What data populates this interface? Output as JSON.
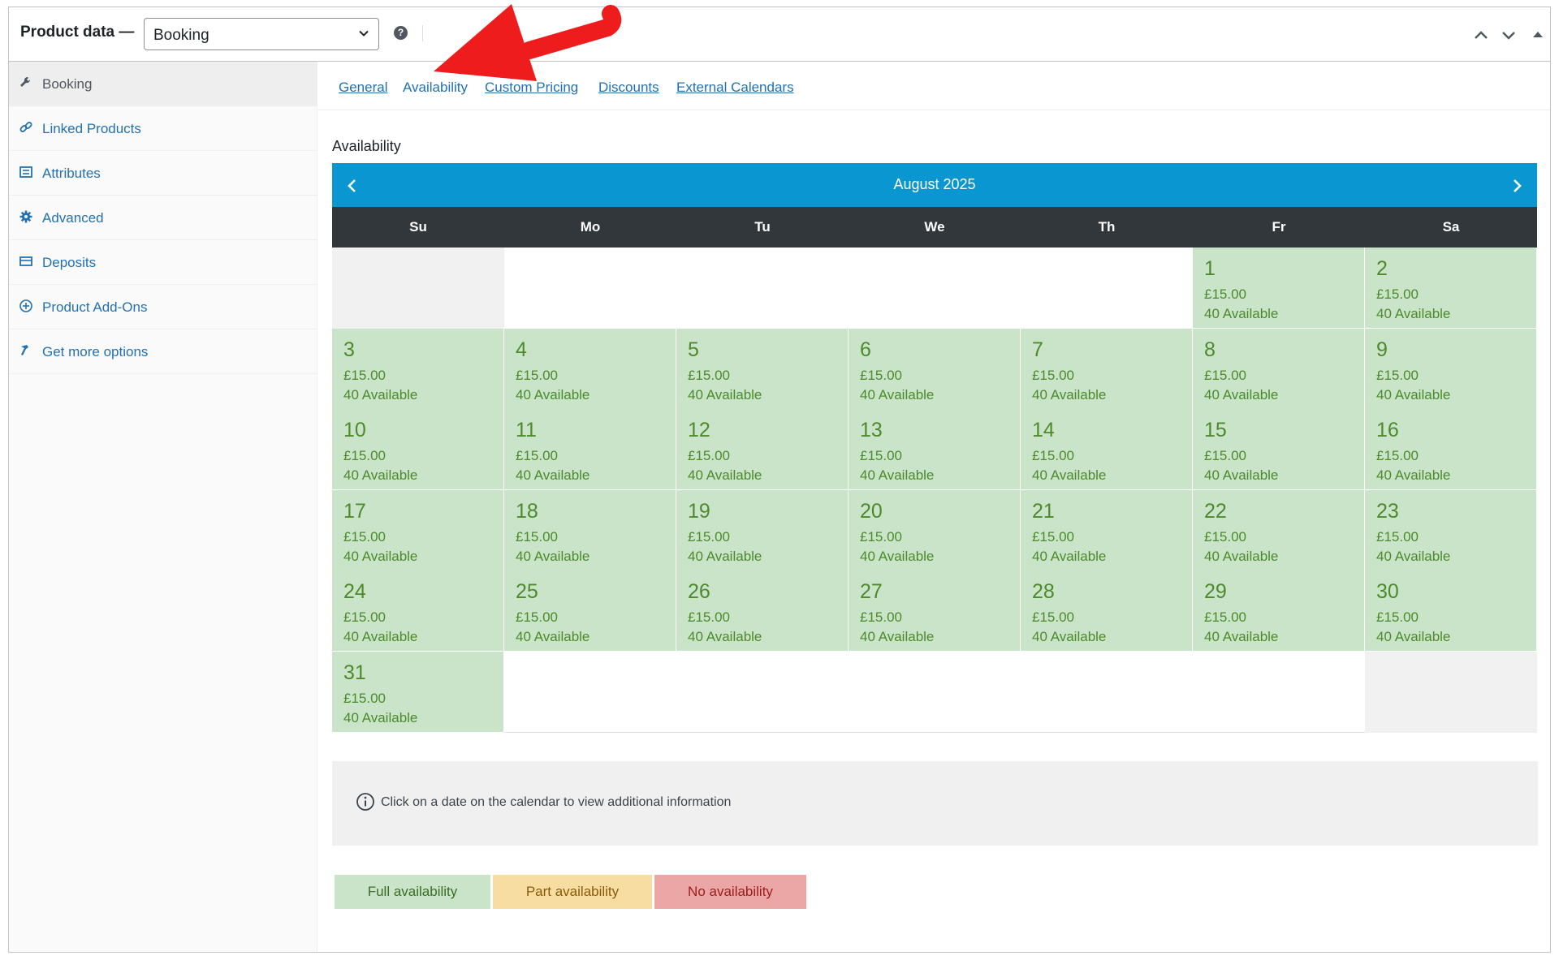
{
  "header": {
    "title": "Product data —",
    "product_type": "Booking",
    "help_icon": "?",
    "controls": [
      "chevron-up-icon",
      "chevron-down-icon",
      "collapse-triangle-icon"
    ]
  },
  "sidebar": {
    "items": [
      {
        "label": "Booking",
        "icon": "wrench-icon",
        "active": true
      },
      {
        "label": "Linked Products",
        "icon": "link-icon",
        "active": false
      },
      {
        "label": "Attributes",
        "icon": "list-icon",
        "active": false
      },
      {
        "label": "Advanced",
        "icon": "gear-icon",
        "active": false
      },
      {
        "label": "Deposits",
        "icon": "card-icon",
        "active": false
      },
      {
        "label": "Product Add-Ons",
        "icon": "plus-circle-icon",
        "active": false
      },
      {
        "label": "Get more options",
        "icon": "hammer-icon",
        "active": false
      }
    ]
  },
  "tabs": [
    {
      "label": "General",
      "current": false
    },
    {
      "label": "Availability",
      "current": true
    },
    {
      "label": "Custom Pricing",
      "current": false
    },
    {
      "label": "Discounts",
      "current": false
    },
    {
      "label": "External Calendars",
      "current": false
    }
  ],
  "section_title": "Availability",
  "calendar": {
    "month": "August 2025",
    "weekdays": [
      "Su",
      "Mo",
      "Tu",
      "We",
      "Th",
      "Fr",
      "Sa"
    ],
    "first_weekday_index": 5,
    "days_in_month": 31,
    "price": "£15.00",
    "availability": "40 Available",
    "colors": {
      "full": "#c9e4c9",
      "header": "#0996d1",
      "weekday_bar": "#32373c",
      "text": "#4c8a2b"
    }
  },
  "info": {
    "text": "Click on a date on the calendar to view additional information"
  },
  "legend": {
    "full": "Full availability",
    "part": "Part availability",
    "none": "No availability"
  },
  "annotation": {
    "arrow_color": "#ee1c1c"
  }
}
